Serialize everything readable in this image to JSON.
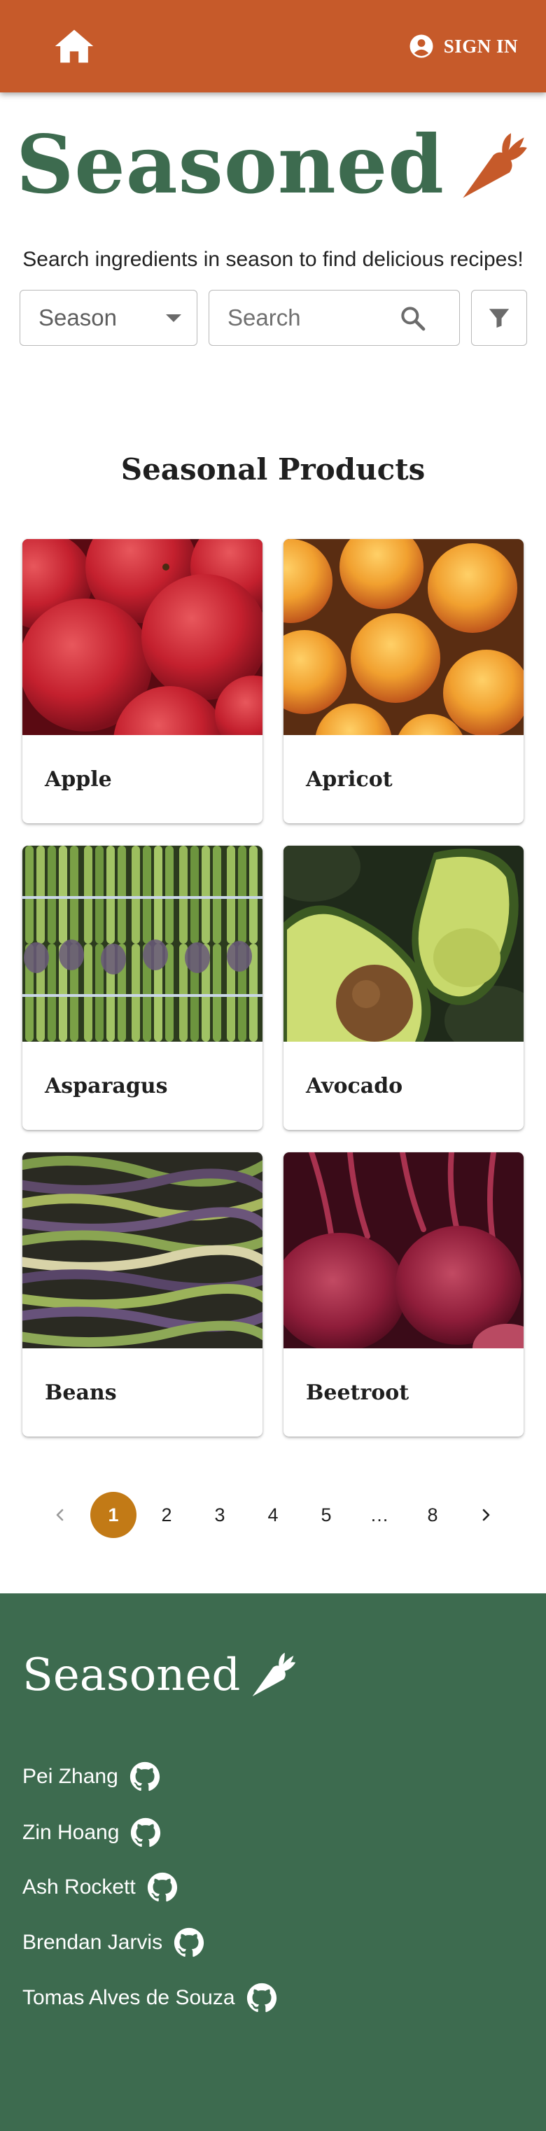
{
  "header": {
    "home_icon": "home-icon",
    "account_icon": "account-circle-icon",
    "sign_in_label": "SIGN IN",
    "color": "#c65a2a"
  },
  "hero": {
    "logo_text": "Seasoned",
    "logo_icon": "carrot-icon",
    "logo_color": "#3d6b4f",
    "tagline": "Search ingredients in season to find delicious recipes!"
  },
  "search": {
    "season_label": "Season",
    "search_placeholder": "Search",
    "search_value": "",
    "search_icon": "search-icon",
    "filter_icon": "filter-icon"
  },
  "products": {
    "title": "Seasonal Products",
    "items": [
      {
        "name": "Apple"
      },
      {
        "name": "Apricot"
      },
      {
        "name": "Asparagus"
      },
      {
        "name": "Avocado"
      },
      {
        "name": "Beans"
      },
      {
        "name": "Beetroot"
      }
    ]
  },
  "pagination": {
    "prev_icon": "chevron-left-icon",
    "next_icon": "chevron-right-icon",
    "pages": [
      "1",
      "2",
      "3",
      "4",
      "5",
      "…",
      "8"
    ],
    "current": "1",
    "active_color": "#c27a16"
  },
  "footer": {
    "logo_text": "Seasoned",
    "logo_icon": "carrot-icon",
    "background": "#3d6b4f",
    "contributors": [
      {
        "name": "Pei Zhang",
        "icon": "github-icon"
      },
      {
        "name": "Zin Hoang",
        "icon": "github-icon"
      },
      {
        "name": "Ash Rockett",
        "icon": "github-icon"
      },
      {
        "name": "Brendan Jarvis",
        "icon": "github-icon"
      },
      {
        "name": "Tomas Alves de Souza",
        "icon": "github-icon"
      }
    ]
  }
}
